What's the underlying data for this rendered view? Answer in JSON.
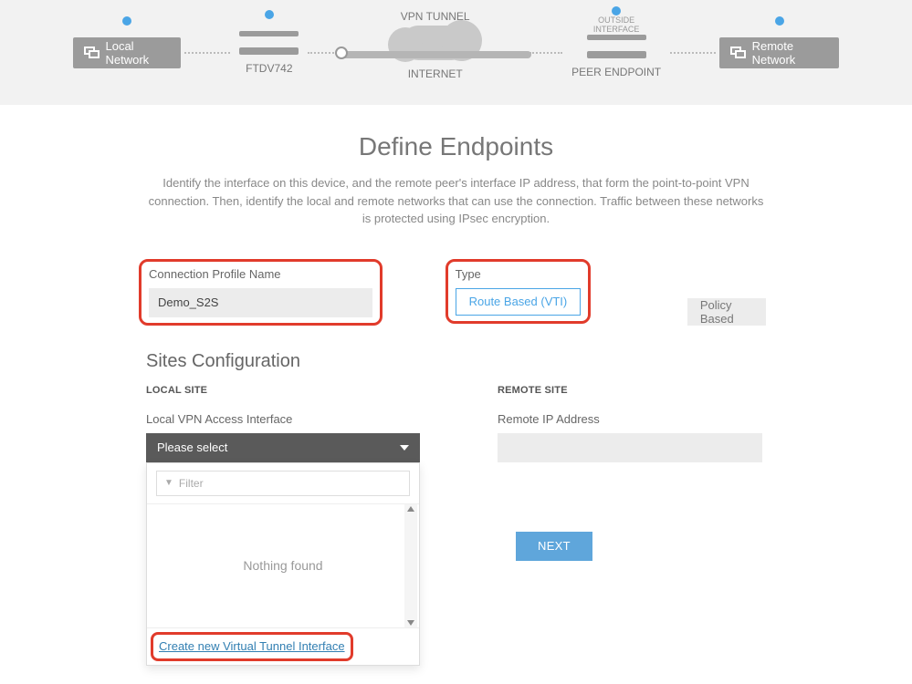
{
  "topology": {
    "local_network": "Local Network",
    "ftd_label": "FTDV742",
    "vpn_tunnel": "VPN TUNNEL",
    "internet": "INTERNET",
    "outside_iface_l1": "OUTSIDE",
    "outside_iface_l2": "INTERFACE",
    "peer_endpoint": "PEER ENDPOINT",
    "remote_network": "Remote Network"
  },
  "page": {
    "title": "Define Endpoints",
    "subtitle": "Identify the interface on this device, and the remote peer's interface IP address, that form the point-to-point VPN connection. Then, identify the local and remote networks that can use the connection. Traffic between these networks is protected using IPsec encryption."
  },
  "profile": {
    "name_label": "Connection Profile Name",
    "name_value": "Demo_S2S",
    "type_label": "Type",
    "type_route": "Route Based (VTI)",
    "type_policy": "Policy Based"
  },
  "sites": {
    "heading": "Sites Configuration",
    "local_site": "LOCAL SITE",
    "remote_site": "REMOTE SITE",
    "local_iface_label": "Local VPN Access Interface",
    "remote_ip_label": "Remote IP Address",
    "select_placeholder": "Please select",
    "filter_placeholder": "Filter",
    "empty": "Nothing found",
    "create_vti": "Create new Virtual Tunnel Interface"
  },
  "actions": {
    "next": "NEXT"
  }
}
